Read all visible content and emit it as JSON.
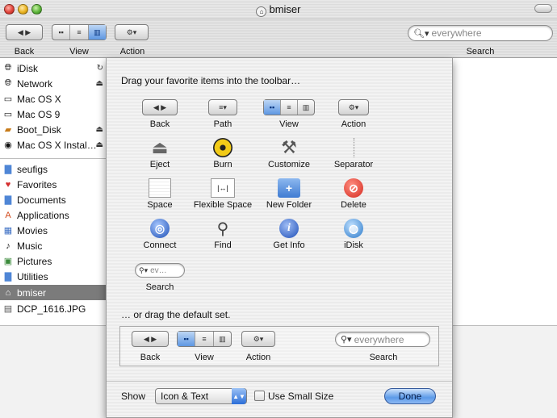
{
  "window": {
    "title": "bmiser"
  },
  "toolbar": {
    "back_label": "Back",
    "view_label": "View",
    "action_label": "Action",
    "search_label": "Search",
    "search_placeholder": "everywhere"
  },
  "sidebar": {
    "devices": [
      {
        "label": "iDisk",
        "icon": "globe-icon",
        "eject": false,
        "sync": true
      },
      {
        "label": "Network",
        "icon": "network-globe-icon",
        "eject": true
      },
      {
        "label": "Mac OS X",
        "icon": "hard-drive-icon",
        "eject": false
      },
      {
        "label": "Mac OS 9",
        "icon": "hard-drive-icon",
        "eject": false
      },
      {
        "label": "Boot_Disk",
        "icon": "disk-icon",
        "eject": true
      },
      {
        "label": "Mac OS X Instal…",
        "icon": "cd-icon",
        "eject": true
      }
    ],
    "places": [
      {
        "label": "seufigs",
        "icon": "folder-icon"
      },
      {
        "label": "Favorites",
        "icon": "heart-icon"
      },
      {
        "label": "Documents",
        "icon": "folder-icon"
      },
      {
        "label": "Applications",
        "icon": "applications-icon"
      },
      {
        "label": "Movies",
        "icon": "movies-icon"
      },
      {
        "label": "Music",
        "icon": "music-icon"
      },
      {
        "label": "Pictures",
        "icon": "pictures-icon"
      },
      {
        "label": "Utilities",
        "icon": "folder-icon"
      },
      {
        "label": "bmiser",
        "icon": "home-icon",
        "selected": true
      },
      {
        "label": "DCP_1616.JPG",
        "icon": "image-file-icon"
      }
    ]
  },
  "sheet": {
    "heading": "Drag your favorite items into the toolbar…",
    "items": [
      {
        "label": "Back",
        "icon": "back-forward-icon"
      },
      {
        "label": "Path",
        "icon": "path-icon"
      },
      {
        "label": "View",
        "icon": "view-icon"
      },
      {
        "label": "Action",
        "icon": "gear-icon"
      },
      {
        "label": "Eject",
        "icon": "eject-icon"
      },
      {
        "label": "Burn",
        "icon": "burn-icon"
      },
      {
        "label": "Customize",
        "icon": "customize-icon"
      },
      {
        "label": "Separator",
        "icon": "separator-icon"
      },
      {
        "label": "Space",
        "icon": "space-icon"
      },
      {
        "label": "Flexible Space",
        "icon": "flexible-space-icon"
      },
      {
        "label": "New Folder",
        "icon": "new-folder-icon"
      },
      {
        "label": "Delete",
        "icon": "delete-icon"
      },
      {
        "label": "Connect",
        "icon": "connect-icon"
      },
      {
        "label": "Find",
        "icon": "find-icon"
      },
      {
        "label": "Get Info",
        "icon": "info-icon"
      },
      {
        "label": "iDisk",
        "icon": "idisk-icon"
      },
      {
        "label": "Search",
        "icon": "search-field-icon",
        "placeholder": "ev…"
      }
    ],
    "default_heading": "… or drag the default set.",
    "default_set": {
      "back_label": "Back",
      "view_label": "View",
      "action_label": "Action",
      "search_label": "Search",
      "search_placeholder": "everywhere"
    },
    "footer": {
      "show_label": "Show",
      "show_value": "Icon & Text",
      "small_size_label": "Use Small Size",
      "small_size_checked": false,
      "done_label": "Done"
    }
  }
}
